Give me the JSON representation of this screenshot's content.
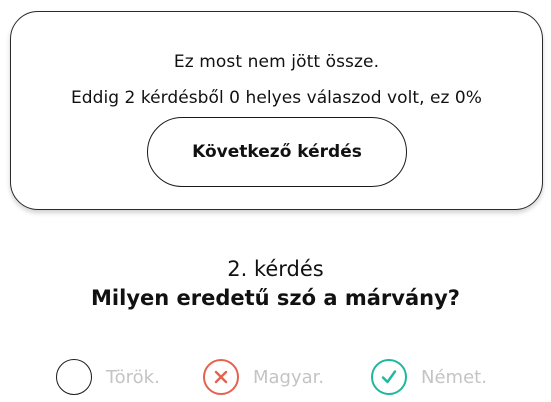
{
  "result": {
    "title": "Ez most nem jött össze.",
    "summary": "Eddig 2 kérdésből 0 helyes válaszod volt, ez 0%",
    "next_button_label": "Következő kérdés"
  },
  "question": {
    "number_label": "2. kérdés",
    "text": "Milyen eredetű szó a márvány?",
    "options": [
      {
        "label": "Török.",
        "state": "unselected",
        "icon": "empty-circle-icon"
      },
      {
        "label": "Magyar.",
        "state": "wrong",
        "icon": "x-icon"
      },
      {
        "label": "Német.",
        "state": "correct",
        "icon": "check-icon"
      }
    ]
  },
  "colors": {
    "wrong": "#e5624f",
    "correct": "#20b79f",
    "option_text": "#c4c4c4",
    "border": "#1a1a1a"
  }
}
